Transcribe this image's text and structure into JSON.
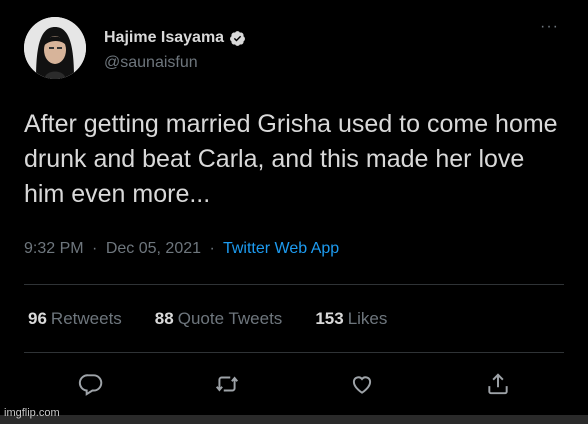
{
  "author": {
    "display_name": "Hajime Isayama",
    "handle": "@saunaisfun",
    "verified": true
  },
  "tweet": {
    "text": "After getting married Grisha used to come home drunk and beat Carla, and this made her love him even more...",
    "time": "9:32 PM",
    "separator": "·",
    "date": "Dec 05, 2021",
    "source": "Twitter Web App"
  },
  "stats": {
    "retweets_count": "96",
    "retweets_label": "Retweets",
    "quote_count": "88",
    "quote_label": "Quote Tweets",
    "likes_count": "153",
    "likes_label": "Likes"
  },
  "actions": [
    {
      "icon": "reply-icon"
    },
    {
      "icon": "retweet-icon"
    },
    {
      "icon": "like-icon"
    },
    {
      "icon": "share-icon"
    }
  ],
  "more_menu": "···",
  "watermark": "imgflip.com",
  "colors": {
    "background": "#000000",
    "text": "#d9d9d9",
    "muted": "#6e767d",
    "link": "#1d9bf0",
    "divider": "#2f3336"
  }
}
